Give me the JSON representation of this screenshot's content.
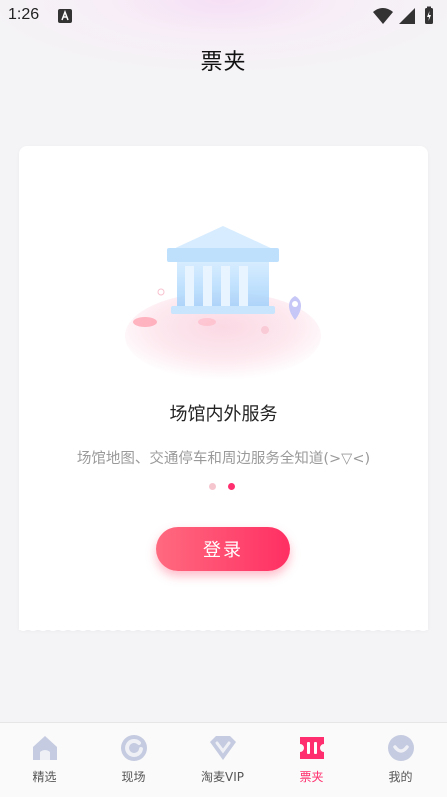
{
  "status_bar": {
    "time": "1:26"
  },
  "header": {
    "title": "票夹"
  },
  "card": {
    "heading": "场馆内外服务",
    "description": "场馆地图、交通停车和周边服务全知道(>▽<)",
    "carousel": {
      "total": 2,
      "active_index": 2
    },
    "login_label": "登录"
  },
  "tabbar": {
    "items": [
      {
        "label": "精选",
        "icon": "home-icon",
        "active": false
      },
      {
        "label": "现场",
        "icon": "live-icon",
        "active": false
      },
      {
        "label": "淘麦VIP",
        "icon": "vip-diamond-icon",
        "active": false
      },
      {
        "label": "票夹",
        "icon": "ticket-icon",
        "active": true
      },
      {
        "label": "我的",
        "icon": "profile-icon",
        "active": false
      }
    ]
  },
  "colors": {
    "accent": "#ff2e6e",
    "tab_icon_inactive": "#c5cbe0"
  }
}
